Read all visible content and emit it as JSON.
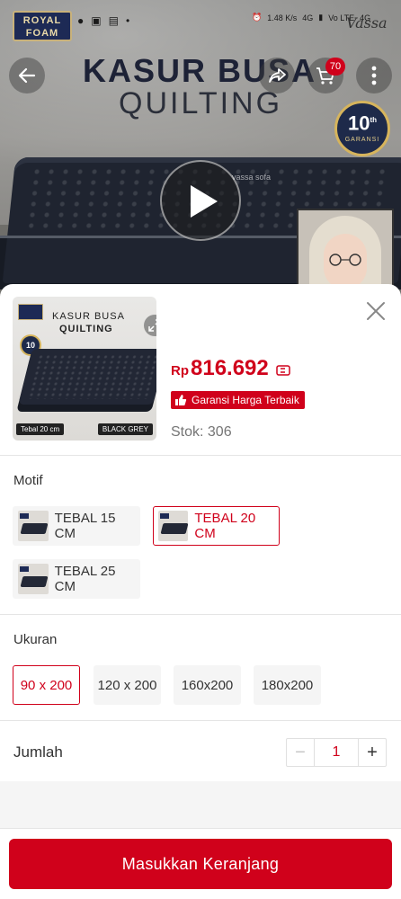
{
  "status_bar": {
    "brand_line1": "ROYAL",
    "brand_line2": "FOAM",
    "network_speed": "1.48",
    "network_unit": "K/s",
    "net1": "4G",
    "net2": "Vo LTE",
    "net3": "4G",
    "watermark_brand": "Vassa"
  },
  "hero": {
    "title": "KASUR BUSA",
    "subtitle": "QUILTING",
    "cart_count": "70",
    "warranty_number": "10",
    "warranty_suffix": "th",
    "warranty_label": "GARANSI",
    "video_watermark": "vassa sofa"
  },
  "product": {
    "thumb_title": "KASUR BUSA",
    "thumb_subtitle": "QUILTING",
    "thumb_badge": "10",
    "thumb_label_left": "Tebal 20 cm",
    "thumb_label_right": "BLACK GREY",
    "price_currency": "Rp",
    "price_value": "816.692",
    "guarantee_label": "Garansi Harga Terbaik",
    "stock_text": "Stok: 306"
  },
  "motif": {
    "label": "Motif",
    "options": [
      {
        "label": "TEBAL 15 CM",
        "selected": false
      },
      {
        "label": "TEBAL 20 CM",
        "selected": true
      },
      {
        "label": "TEBAL 25 CM",
        "selected": false
      }
    ]
  },
  "ukuran": {
    "label": "Ukuran",
    "options": [
      {
        "label": "90 x 200",
        "selected": true
      },
      {
        "label": "120 x 200",
        "selected": false
      },
      {
        "label": "160x200",
        "selected": false
      },
      {
        "label": "180x200",
        "selected": false
      }
    ]
  },
  "quantity": {
    "label": "Jumlah",
    "value": "1",
    "minus": "−",
    "plus": "+"
  },
  "cta": {
    "label": "Masukkan Keranjang"
  },
  "colors": {
    "accent": "#d0011b",
    "muted_text": "#757575",
    "chip_bg": "#f5f5f5"
  },
  "icons": [
    "back-arrow-icon",
    "share-icon",
    "cart-icon",
    "more-icon",
    "play-icon",
    "expand-icon",
    "close-icon",
    "coin-icon",
    "thumbs-up-icon"
  ]
}
